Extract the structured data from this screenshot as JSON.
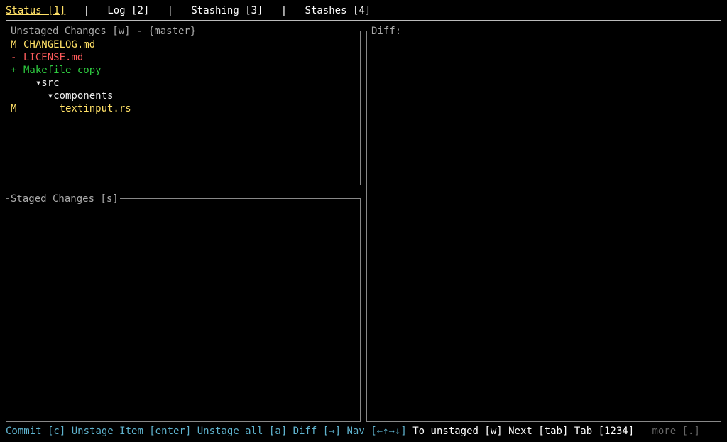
{
  "tabs": {
    "items": [
      {
        "label": "Status [1]",
        "active": true
      },
      {
        "label": "Log [2]",
        "active": false
      },
      {
        "label": "Stashing [3]",
        "active": false
      },
      {
        "label": "Stashes [4]",
        "active": false
      }
    ],
    "sep": "   |   "
  },
  "unstaged": {
    "title": "Unstaged Changes [w] - {master}",
    "rows": [
      {
        "status": "M",
        "class": "c-modified",
        "indent": 0,
        "name": "CHANGELOG.md"
      },
      {
        "status": "-",
        "class": "c-deleted",
        "indent": 0,
        "name": "LICENSE.md"
      },
      {
        "status": "+",
        "class": "c-added",
        "indent": 0,
        "name": "Makefile copy"
      },
      {
        "status": "",
        "class": "c-tree",
        "indent": 1,
        "name": "▾src"
      },
      {
        "status": "",
        "class": "c-tree",
        "indent": 2,
        "name": "▾components"
      },
      {
        "status": "M",
        "class": "c-modified",
        "indent": 3,
        "name": "textinput.rs"
      }
    ]
  },
  "staged": {
    "title": "Staged Changes [s]"
  },
  "diff": {
    "title": "Diff:"
  },
  "footer": {
    "commit": "Commit [c]",
    "unstage_item": "Unstage Item [enter]",
    "unstage_all": "Unstage all [a]",
    "diff": "Diff [→]",
    "nav_label": "Nav",
    "nav_keys": "[←↑→↓]",
    "to_unstaged": "To unstaged [w]",
    "next": "Next [tab]",
    "tab": "Tab [1234]",
    "more": "more [.]"
  }
}
